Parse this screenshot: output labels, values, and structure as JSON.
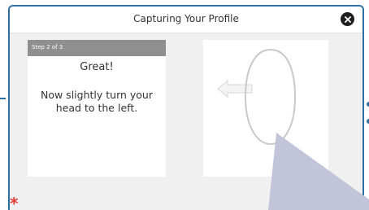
{
  "modal": {
    "title": "Capturing Your Profile",
    "close_icon": "close-icon"
  },
  "instruction": {
    "step": "Step 2 of 3",
    "headline": "Great!",
    "text": "Now slightly turn your head to the left."
  },
  "camera": {
    "guide_icon": "head-outline-icon",
    "arrow_icon": "arrow-left-icon"
  },
  "footer": {
    "required_mark": "*"
  },
  "colors": {
    "accent": "#2d6fa3",
    "required": "#e53935",
    "step_bar": "#8f8f8f"
  }
}
